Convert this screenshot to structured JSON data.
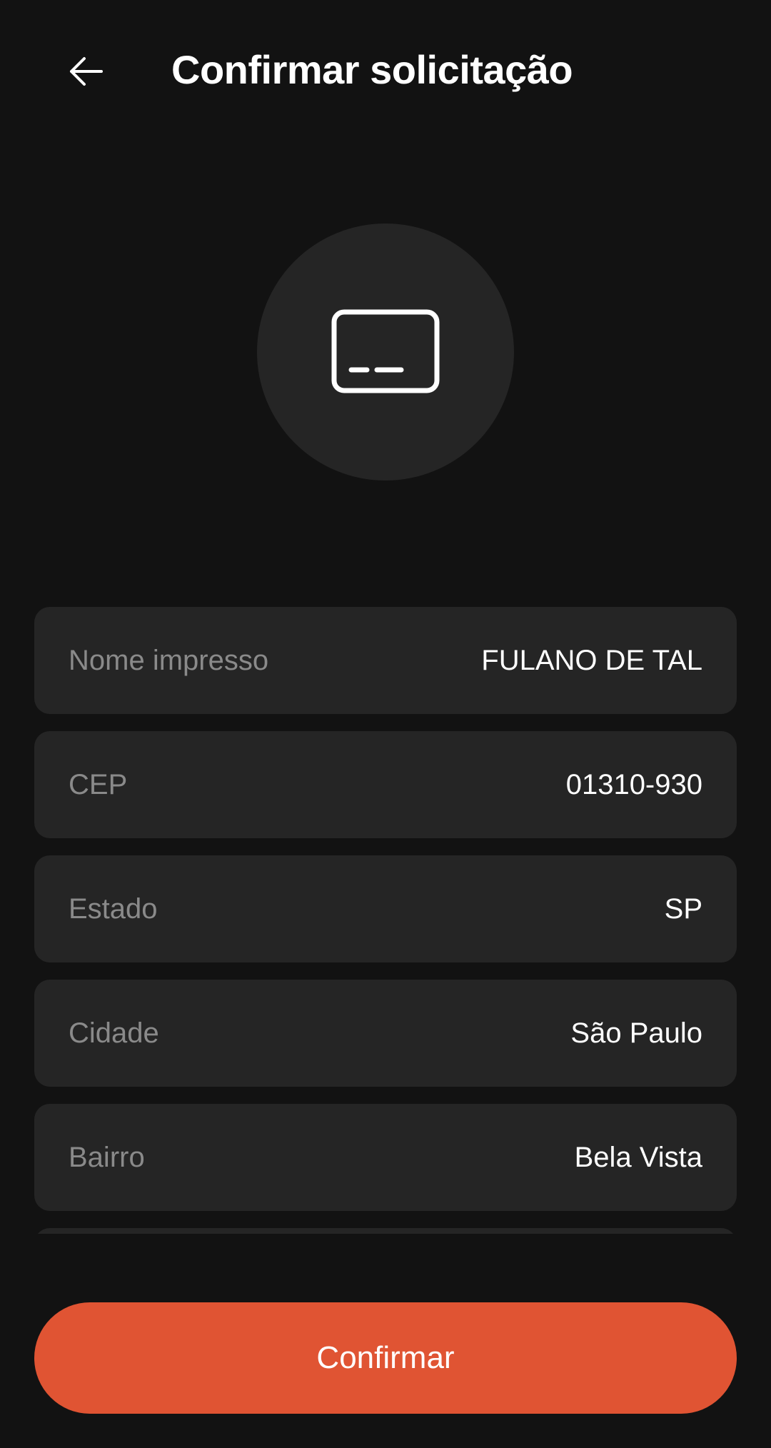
{
  "header": {
    "back_icon": "arrow-left-icon",
    "title": "Confirmar solicitação"
  },
  "hero": {
    "icon": "card-icon"
  },
  "fields": [
    {
      "label": "Nome impresso",
      "value": "FULANO DE TAL"
    },
    {
      "label": "CEP",
      "value": "01310-930"
    },
    {
      "label": "Estado",
      "value": "SP"
    },
    {
      "label": "Cidade",
      "value": "São Paulo"
    },
    {
      "label": "Bairro",
      "value": "Bela Vista"
    },
    {
      "label": "",
      "value": ""
    }
  ],
  "confirm_button": {
    "label": "Confirmar"
  },
  "colors": {
    "background": "#121212",
    "surface": "#252525",
    "accent": "#e05433",
    "label": "#8a8a8a",
    "text": "#ffffff"
  }
}
